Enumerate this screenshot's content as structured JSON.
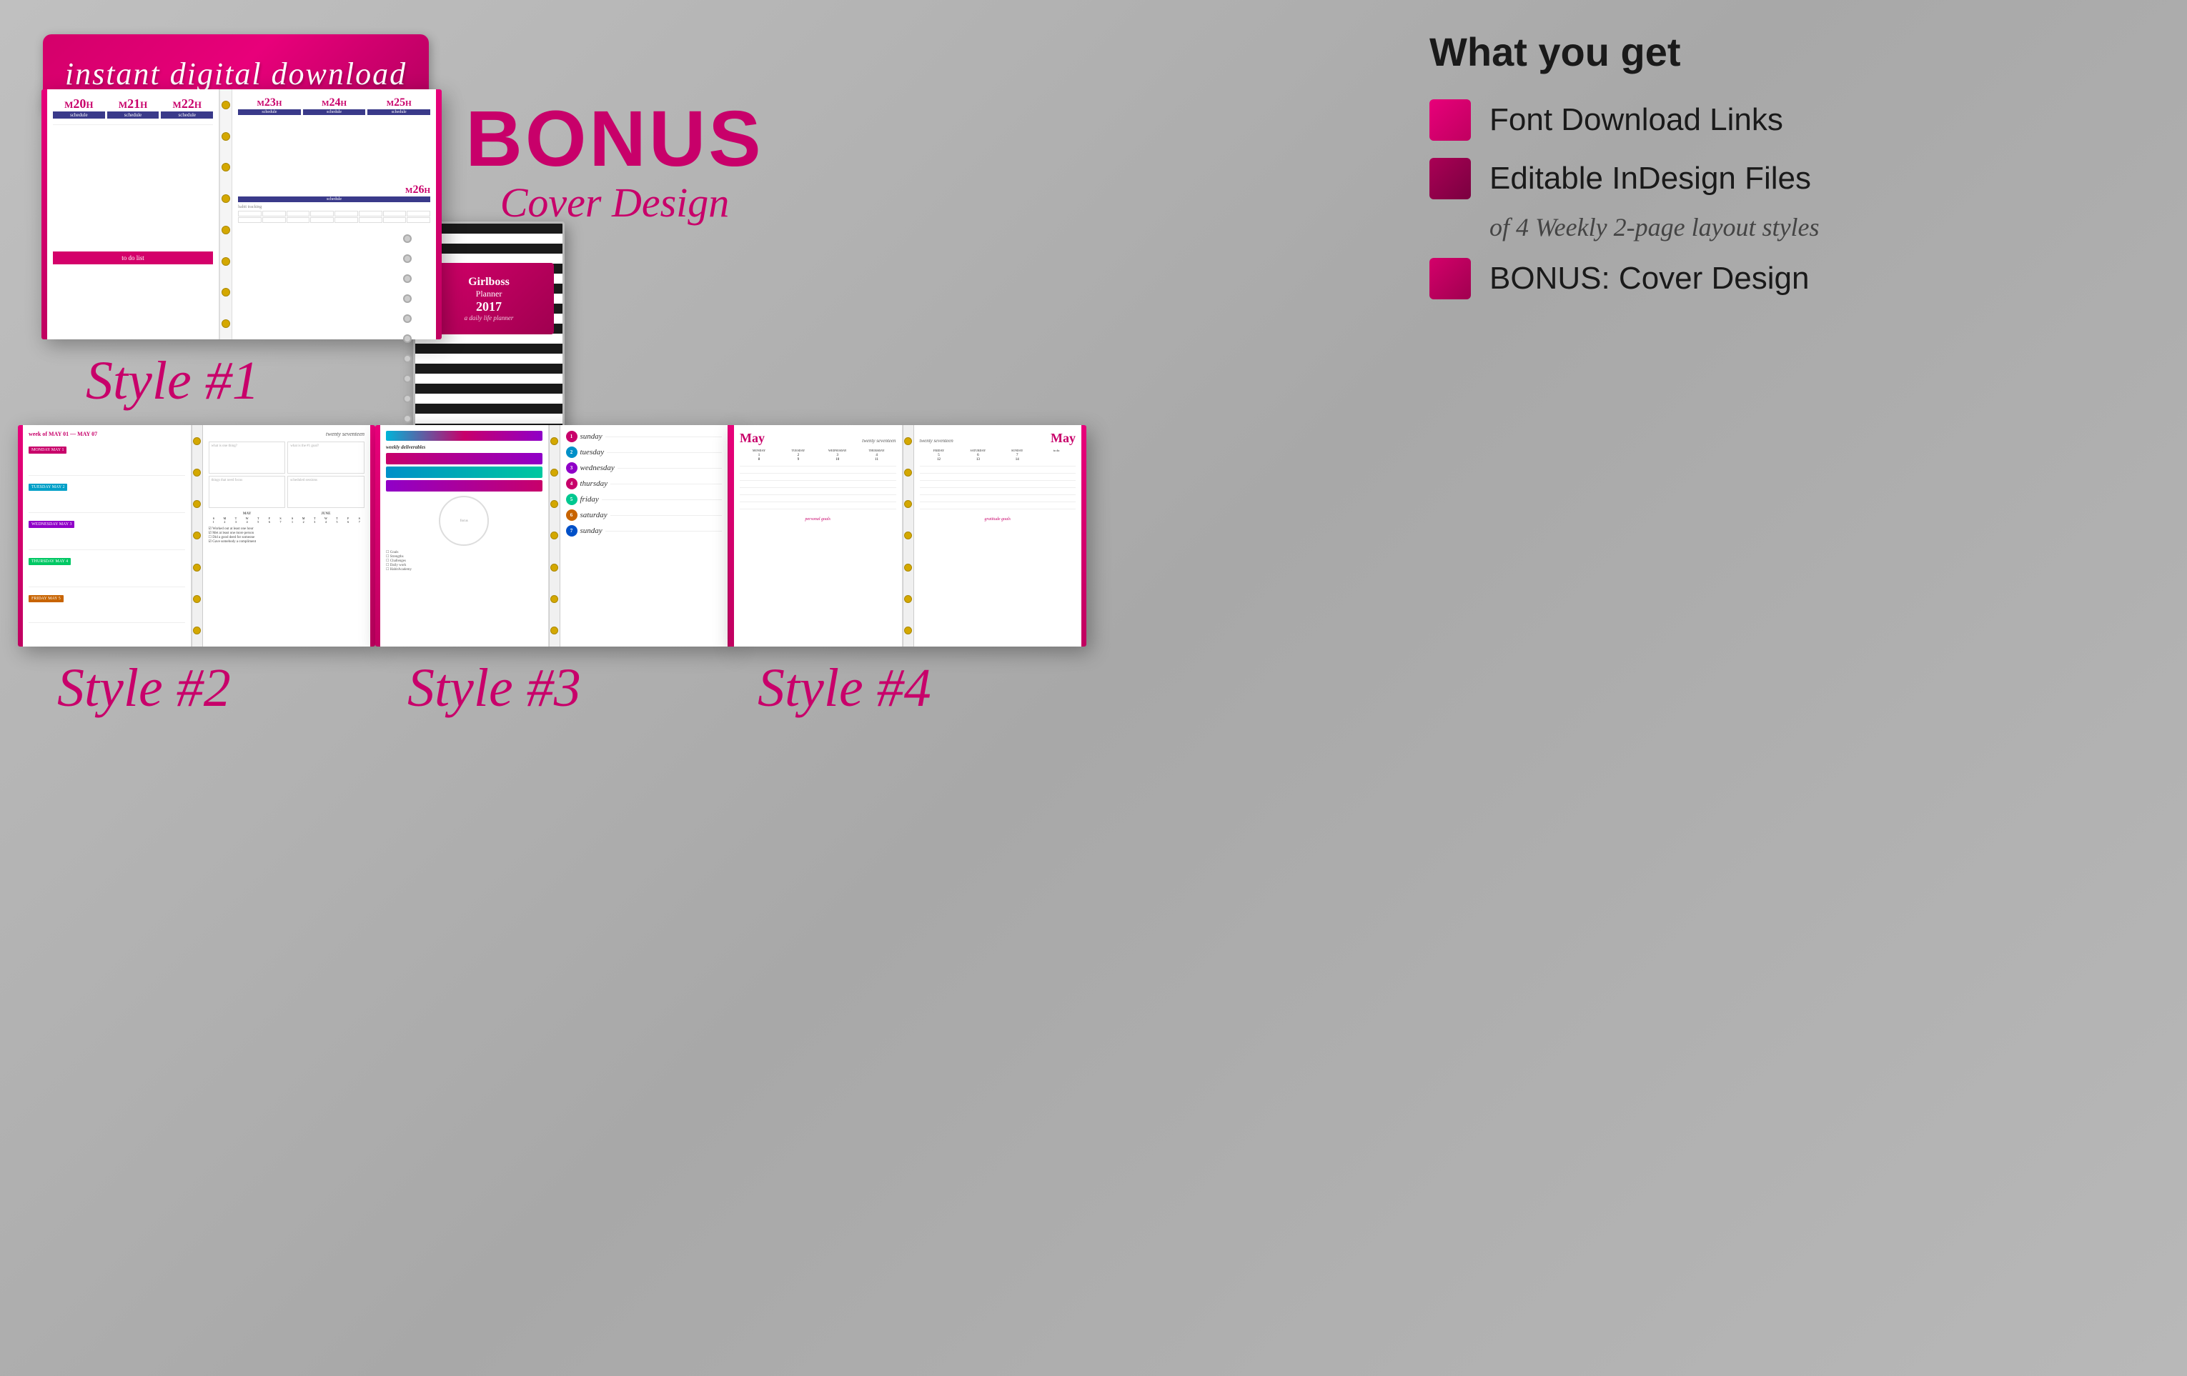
{
  "background": {
    "color": "#b4b4b4"
  },
  "banner": {
    "text": "instant digital download"
  },
  "what_you_get": {
    "title": "What you get",
    "items": [
      {
        "id": "font-links",
        "label": "Font Download Links",
        "icon_style": "light"
      },
      {
        "id": "indesign",
        "label": "Editable InDesign Files",
        "icon_style": "dark"
      },
      {
        "id": "layout-sub",
        "label": "of 4 Weekly 2-page layout styles",
        "is_sub": true
      },
      {
        "id": "bonus-cover",
        "label": "BONUS: Cover Design",
        "icon_style": "medium"
      }
    ]
  },
  "bonus": {
    "title": "BONUS",
    "subtitle": "Cover Design"
  },
  "styles": [
    {
      "id": "style1",
      "label": "Style #1"
    },
    {
      "id": "style2",
      "label": "Style #2"
    },
    {
      "id": "style3",
      "label": "Style #3"
    },
    {
      "id": "style4",
      "label": "Style #4"
    }
  ],
  "notebook": {
    "title": "Girlboss",
    "subtitle": "Planner",
    "year": "2017",
    "tagline": "a daily life planner"
  },
  "planner1": {
    "days_left": [
      "20",
      "21",
      "22"
    ],
    "days_right": [
      "23",
      "24",
      "25",
      "26"
    ],
    "label": "schedule",
    "todo": "to do list",
    "habit": "habit tracking"
  },
  "planner2": {
    "header": "week of MAY 01 – MAY 07",
    "right_header": "twenty seventeen",
    "days": [
      "MONDAY MAY 1",
      "TUESDAY MAY 2",
      "WEDNESDAY MAY 3",
      "THURSDAY MAY 4",
      "FRIDAY MAY 5"
    ]
  },
  "planner3": {
    "header": "weekly deliverables",
    "days": [
      {
        "num": "1",
        "name": "sunday",
        "color": "#c8006a"
      },
      {
        "num": "2",
        "name": "tuesday",
        "color": "#0090c8"
      },
      {
        "num": "3",
        "name": "wednesday",
        "color": "#9000c8"
      },
      {
        "num": "4",
        "name": "thursday",
        "color": "#c8006a"
      },
      {
        "num": "5",
        "name": "friday",
        "color": "#00c890"
      },
      {
        "num": "6",
        "name": "saturday",
        "color": "#c86400"
      },
      {
        "num": "7",
        "name": "sunday",
        "color": "#0050c8"
      }
    ]
  },
  "planner4": {
    "month": "May",
    "year_label": "twenty seventeen",
    "days_header": [
      "MONDAY",
      "TUESDAY",
      "WEDNESDAY",
      "THURSDAY"
    ],
    "days_header2": [
      "FRIDAY",
      "SATURDAY",
      "SUNDAY"
    ],
    "footer1": "personal goals",
    "footer2": "gratitude goals"
  }
}
